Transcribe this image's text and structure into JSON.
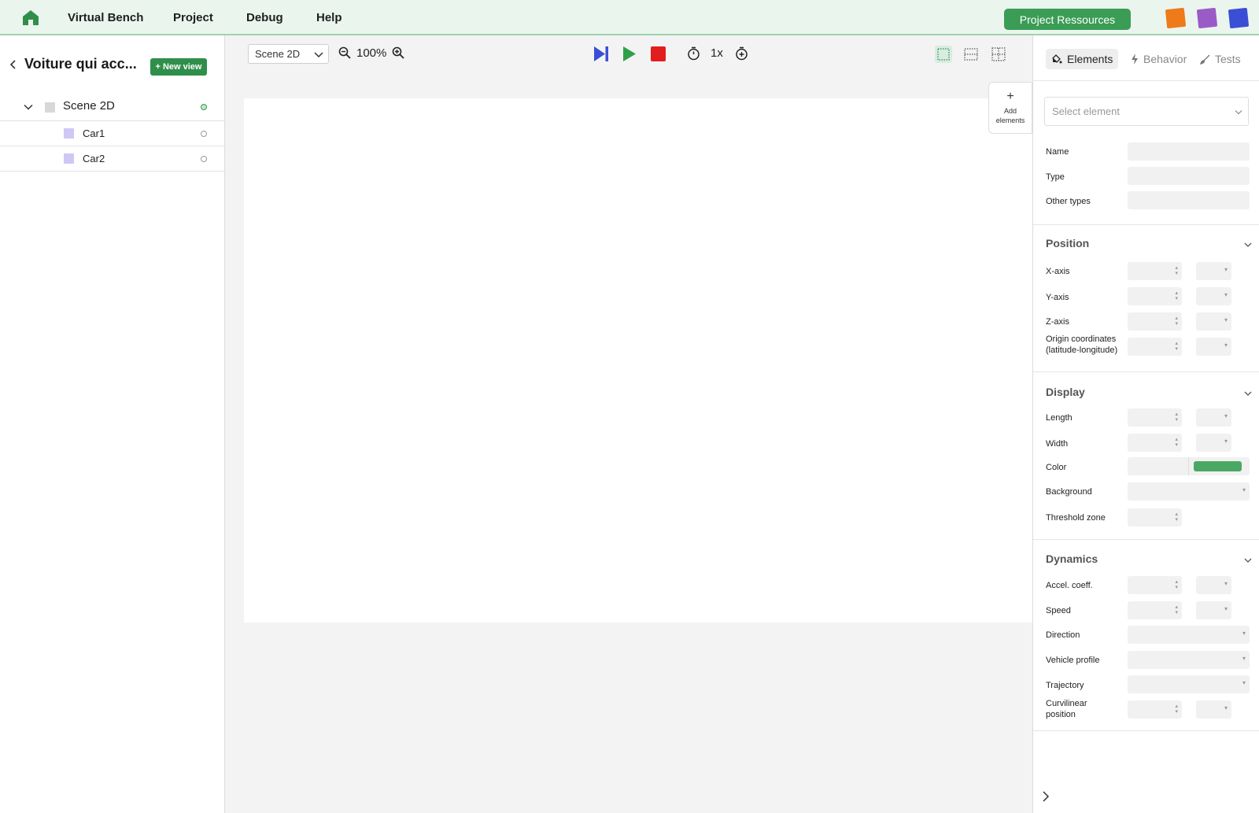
{
  "topbar": {
    "menu": [
      "Virtual Bench",
      "Project",
      "Debug",
      "Help"
    ],
    "project_resources_label": "Project Ressources",
    "avatar_colors": [
      "#ee7a1a",
      "#9a5bc6",
      "#3a4fd6"
    ]
  },
  "left": {
    "project_title": "Voiture qui acc...",
    "new_view_label": "+ New view",
    "tree": [
      {
        "label": "Scene 2D",
        "level": 0,
        "status": "active"
      },
      {
        "label": "Car1",
        "level": 1,
        "status": "inactive"
      },
      {
        "label": "Car2",
        "level": 1,
        "status": "inactive"
      }
    ]
  },
  "toolbar": {
    "scene_select": "Scene 2D",
    "zoom": "100%",
    "speed": "1x"
  },
  "canvas": {
    "add_elements_plus": "+",
    "add_elements_label": "Add elements"
  },
  "right": {
    "tabs": [
      "Elements",
      "Behavior",
      "Tests"
    ],
    "select_element_placeholder": "Select element",
    "general": {
      "name": "Name",
      "type": "Type",
      "other_types": "Other types"
    },
    "position": {
      "title": "Position",
      "x_axis": "X-axis",
      "y_axis": "Y-axis",
      "z_axis": "Z-axis",
      "origin_line1": "Origin coordinates",
      "origin_line2": "(latitude-longitude)"
    },
    "display": {
      "title": "Display",
      "length": "Length",
      "width": "Width",
      "color": "Color",
      "color_value": "#4aa865",
      "background": "Background",
      "threshold": "Threshold zone"
    },
    "dynamics": {
      "title": "Dynamics",
      "accel": "Accel. coeff.",
      "speed": "Speed",
      "direction": "Direction",
      "vehicle_profile": "Vehicle profile",
      "trajectory": "Trajectory",
      "curv_line1": "Curvilinear",
      "curv_line2": "position"
    }
  },
  "colors": {
    "brand_green": "#3a9c55",
    "step_blue": "#3a4fd6",
    "play_green": "#2fa04a",
    "stop_red": "#e11d1d"
  }
}
